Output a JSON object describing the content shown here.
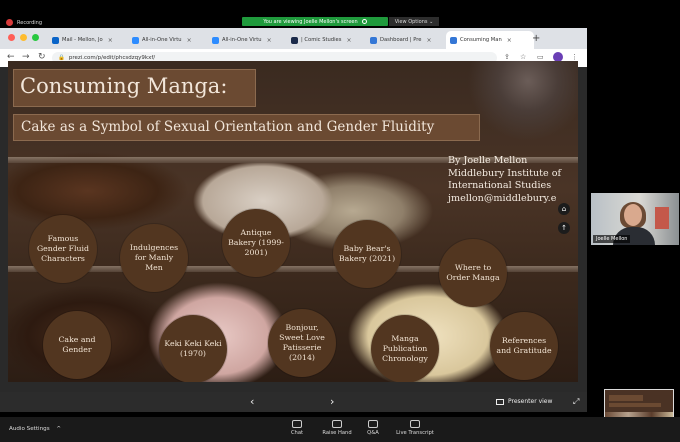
{
  "zoom": {
    "recording_label": "Recording",
    "viewing_banner": "You are viewing Joelle Mellon's screen",
    "view_options": "View Options ⌄",
    "audio_settings": "Audio Settings",
    "audio_caret": "^",
    "controls": [
      {
        "label": "Chat"
      },
      {
        "label": "Raise Hand"
      },
      {
        "label": "Q&A"
      },
      {
        "label": "Live Transcript"
      }
    ],
    "participant_name": "Joelle Mellon"
  },
  "browser": {
    "tabs": [
      {
        "label": "Mail - Mellon, Jo",
        "favicon_color": "#0a64c8"
      },
      {
        "label": "All-in-One Virtu",
        "favicon_color": "#2d8cff"
      },
      {
        "label": "All-in-One Virtu",
        "favicon_color": "#2d8cff"
      },
      {
        "label": "| Comic Studies",
        "favicon_color": "#1b2a4a"
      },
      {
        "label": "Dashboard | Pre",
        "favicon_color": "#3477d6"
      },
      {
        "label": "Consuming Man",
        "favicon_color": "#3477d6",
        "active": true
      }
    ],
    "new_tab": "+",
    "url": "prezi.com/p/edit/phcsdzqy9kxf/"
  },
  "slide": {
    "title": "Consuming Manga:",
    "subtitle": "Cake as a Symbol of Sexual Orientation and Gender Fluidity",
    "author_lines": [
      "By Joelle Mellon",
      "Middlebury Institute of",
      "International Studies",
      "jmellon@middlebury.e"
    ],
    "topics": [
      {
        "label": "Famous Gender Fluid Characters"
      },
      {
        "label": "Indulgences for Manly Men"
      },
      {
        "label": "Antique Bakery (1999-2001)"
      },
      {
        "label": "Baby Bear's Bakery (2021)"
      },
      {
        "label": "Where to Order Manga"
      },
      {
        "label": "Cake and Gender"
      },
      {
        "label": "Keki Keki Keki (1970)"
      },
      {
        "label": "Bonjour, Sweet Love Patisserie (2014)"
      },
      {
        "label": "Manga Publication Chronology"
      },
      {
        "label": "References and Gratitude"
      }
    ]
  },
  "presenter_bar": {
    "prev": "‹",
    "next": "›",
    "presenter_view": "Presenter view",
    "fullscreen": "⤢"
  }
}
